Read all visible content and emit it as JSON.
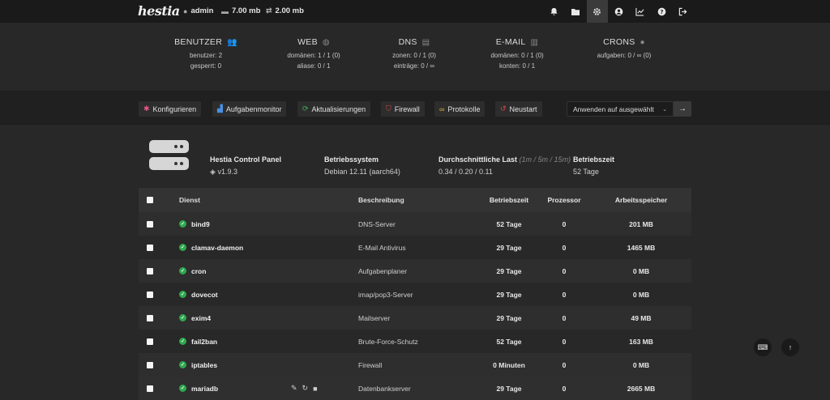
{
  "topbar": {
    "logo": "hestia",
    "user": "admin",
    "disk": "7.00 mb",
    "bandwidth": "2.00 mb",
    "icons": [
      "bell-icon",
      "folder-icon",
      "gear-icon",
      "user-circle-icon",
      "chart-icon",
      "help-icon",
      "logout-icon"
    ]
  },
  "stats": [
    {
      "title": "BENUTZER",
      "icon": "users-icon",
      "lines": [
        "benutzer: 2",
        "gesperrt: 0"
      ]
    },
    {
      "title": "WEB",
      "icon": "globe-icon",
      "lines": [
        "domänen: 1 / 1 (0)",
        "aliase: 0 / 1"
      ]
    },
    {
      "title": "DNS",
      "icon": "book-icon",
      "lines": [
        "zonen: 0 / 1 (0)",
        "einträge: 0 / ∞"
      ]
    },
    {
      "title": "E-MAIL",
      "icon": "mail-server-icon",
      "lines": [
        "domänen: 0 / 1 (0)",
        "konten: 0 / 1"
      ]
    },
    {
      "title": "CRONS",
      "icon": "clock-icon",
      "lines": [
        "aufgaben: 0 / ∞ (0)"
      ]
    }
  ],
  "toolbar": {
    "buttons": [
      {
        "label": "Konfigurieren",
        "icon": "gear-icon",
        "color": "#e05a8a"
      },
      {
        "label": "Aufgabenmonitor",
        "icon": "chart-icon",
        "color": "#4a8fe0"
      },
      {
        "label": "Aktualisierungen",
        "icon": "refresh-icon",
        "color": "#3cb55a"
      },
      {
        "label": "Firewall",
        "icon": "shield-icon",
        "color": "#e04848"
      },
      {
        "label": "Protokolle",
        "icon": "binoculars-icon",
        "color": "#e0b030"
      },
      {
        "label": "Neustart",
        "icon": "undo-icon",
        "color": "#e04848"
      }
    ],
    "select_value": "Anwenden auf ausgewählt",
    "go_icon": "arrow-right-icon"
  },
  "server": {
    "panel_label": "Hestia Control Panel",
    "panel_version": "v1.9.3",
    "os_label": "Betriebssystem",
    "os_value": "Debian 12.11 (aarch64)",
    "load_label": "Durchschnittliche Last",
    "load_sub": "(1m / 5m / 15m)",
    "load_value": "0.34 / 0.20 / 0.11",
    "uptime_label": "Betriebszeit",
    "uptime_value": "52 Tage"
  },
  "table": {
    "headers": {
      "service": "Dienst",
      "description": "Beschreibung",
      "uptime": "Betriebszeit",
      "cpu": "Prozessor",
      "memory": "Arbeitsspeicher"
    },
    "rows": [
      {
        "name": "bind9",
        "desc": "DNS-Server",
        "uptime": "52 Tage",
        "cpu": "0",
        "mem": "201 MB"
      },
      {
        "name": "clamav-daemon",
        "desc": "E-Mail Antivirus",
        "uptime": "29 Tage",
        "cpu": "0",
        "mem": "1465 MB"
      },
      {
        "name": "cron",
        "desc": "Aufgabenplaner",
        "uptime": "29 Tage",
        "cpu": "0",
        "mem": "0 MB"
      },
      {
        "name": "dovecot",
        "desc": "imap/pop3-Server",
        "uptime": "29 Tage",
        "cpu": "0",
        "mem": "0 MB"
      },
      {
        "name": "exim4",
        "desc": "Mailserver",
        "uptime": "29 Tage",
        "cpu": "0",
        "mem": "49 MB"
      },
      {
        "name": "fail2ban",
        "desc": "Brute-Force-Schutz",
        "uptime": "52 Tage",
        "cpu": "0",
        "mem": "163 MB"
      },
      {
        "name": "iptables",
        "desc": "Firewall",
        "uptime": "0 Minuten",
        "cpu": "0",
        "mem": "0 MB"
      },
      {
        "name": "mariadb",
        "desc": "Datenbankserver",
        "uptime": "29 Tage",
        "cpu": "0",
        "mem": "2665 MB"
      }
    ]
  },
  "floating": [
    "keyboard-icon",
    "arrow-up-icon"
  ]
}
